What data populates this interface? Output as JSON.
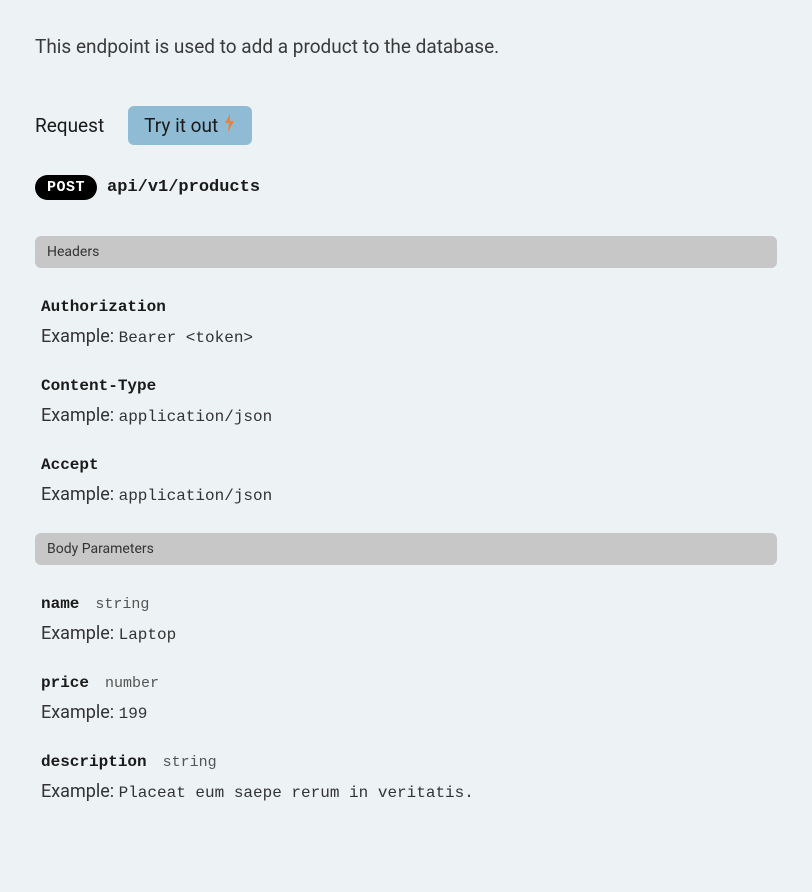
{
  "description": "This endpoint is used to add a product to the database.",
  "tabs": {
    "request_label": "Request",
    "try_it_out_label": "Try it out"
  },
  "method": "POST",
  "path": "api/v1/products",
  "sections": {
    "headers_label": "Headers",
    "body_params_label": "Body Parameters"
  },
  "example_label": "Example:",
  "headers": [
    {
      "name": "Authorization",
      "example": "Bearer <token>"
    },
    {
      "name": "Content-Type",
      "example": "application/json"
    },
    {
      "name": "Accept",
      "example": "application/json"
    }
  ],
  "body_params": [
    {
      "name": "name",
      "type": "string",
      "example": "Laptop"
    },
    {
      "name": "price",
      "type": "number",
      "example": "199"
    },
    {
      "name": "description",
      "type": "string",
      "example": "Placeat eum saepe rerum in veritatis."
    }
  ]
}
